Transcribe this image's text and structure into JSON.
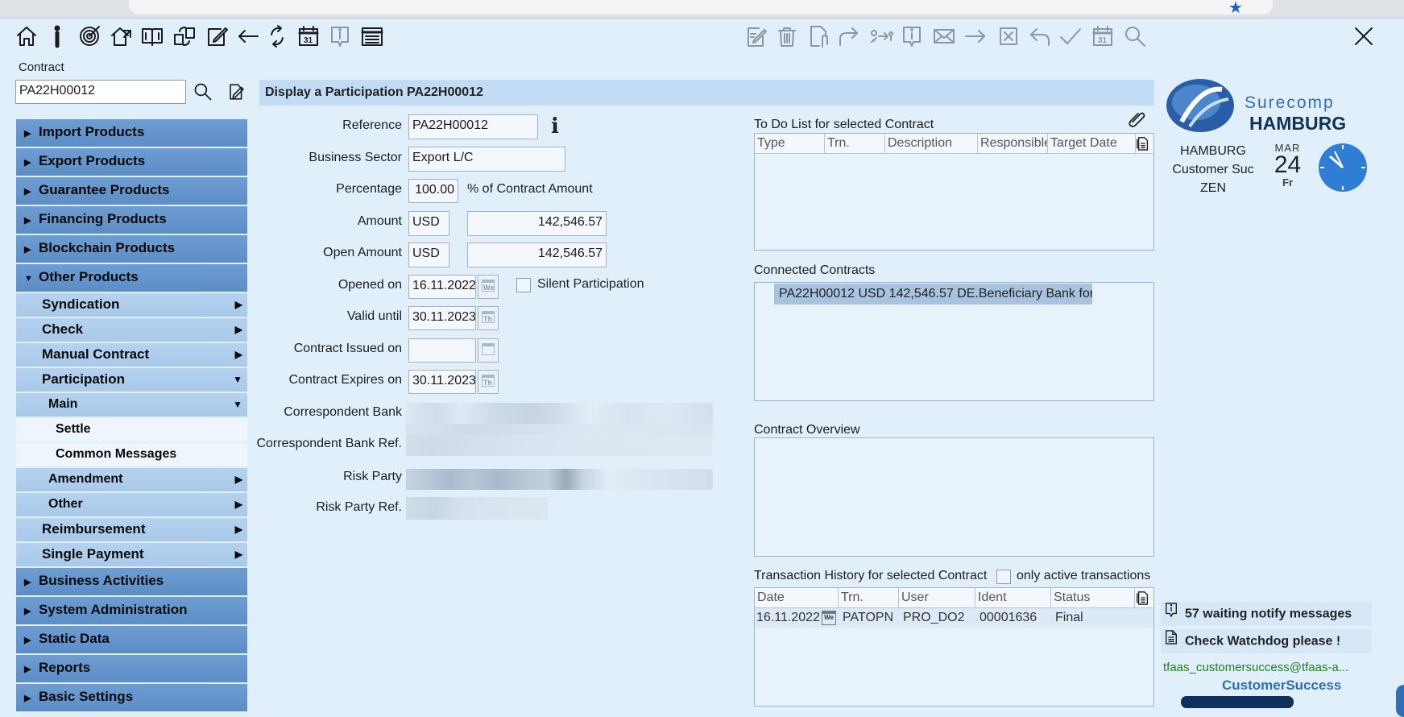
{
  "toolbar_left_icons": [
    "home-icon",
    "info-icon",
    "target-icon",
    "export-icon",
    "book-icon",
    "exchange-icon",
    "edit-icon",
    "back-arrow-icon",
    "refresh-icon",
    "calendar-icon",
    "info-box-icon",
    "list-icon"
  ],
  "toolbar_right_icons": [
    "edit-doc-icon",
    "trash-icon",
    "attach-doc-icon",
    "forward-icon",
    "route-icon",
    "info-box-icon",
    "mail-icon",
    "arrow-right-icon",
    "cancel-box-icon",
    "undo-icon",
    "check-icon",
    "calendar-icon",
    "search-icon"
  ],
  "contract_search": {
    "label": "Contract",
    "value": "PA22H00012"
  },
  "sidebar": {
    "top_items": [
      {
        "label": "Import Products"
      },
      {
        "label": "Export Products"
      },
      {
        "label": "Guarantee Products"
      },
      {
        "label": "Financing Products"
      },
      {
        "label": "Blockchain Products"
      },
      {
        "label": "Other Products"
      }
    ],
    "other_sub": [
      {
        "label": "Syndication"
      },
      {
        "label": "Check"
      },
      {
        "label": "Manual Contract"
      },
      {
        "label": "Participation"
      }
    ],
    "participation_sub": {
      "main": "Main",
      "main_children": [
        "Settle",
        "Common Messages"
      ],
      "amendment": "Amendment",
      "other": "Other"
    },
    "other_sub2": [
      {
        "label": "Reimbursement"
      },
      {
        "label": "Single Payment"
      }
    ],
    "bottom_items": [
      {
        "label": "Business Activities"
      },
      {
        "label": "System Administration"
      },
      {
        "label": "Static Data"
      },
      {
        "label": "Reports"
      },
      {
        "label": "Basic Settings"
      }
    ]
  },
  "page": {
    "title": "Display a Participation PA22H00012"
  },
  "form": {
    "reference": {
      "label": "Reference",
      "value": "PA22H00012"
    },
    "business_sector": {
      "label": "Business Sector",
      "value": "Export L/C"
    },
    "percentage": {
      "label": "Percentage",
      "value": "100.00",
      "suffix": "% of Contract Amount"
    },
    "amount": {
      "label": "Amount",
      "currency": "USD",
      "value": "142,546.57"
    },
    "open_amount": {
      "label": "Open Amount",
      "currency": "USD",
      "value": "142,546.57"
    },
    "opened_on": {
      "label": "Opened on",
      "value": "16.11.2022"
    },
    "silent_participation": {
      "label": "Silent Participation"
    },
    "valid_until": {
      "label": "Valid until",
      "value": "30.11.2023"
    },
    "contract_issued_on": {
      "label": "Contract Issued on",
      "value": ""
    },
    "contract_expires_on": {
      "label": "Contract Expires on",
      "value": "30.11.2023"
    },
    "correspondent_bank": {
      "label": "Correspondent Bank"
    },
    "correspondent_bank_ref": {
      "label": "Correspondent Bank Ref."
    },
    "risk_party": {
      "label": "Risk Party"
    },
    "risk_party_ref": {
      "label": "Risk Party Ref."
    }
  },
  "todo": {
    "label": "To Do List for selected Contract",
    "columns": [
      "Type",
      "Trn.",
      "Description",
      "Responsible",
      "Target Date"
    ]
  },
  "connected": {
    "label": "Connected Contracts",
    "items": [
      "PA22H00012 USD 142,546.57 DE.Beneficiary Bank for"
    ]
  },
  "overview": {
    "label": "Contract Overview"
  },
  "history": {
    "label": "Transaction History for selected Contract",
    "only_active": "only active transactions",
    "columns": [
      "Date",
      "Trn.",
      "User",
      "Ident",
      "Status"
    ],
    "rows": [
      {
        "date": "16.11.2022",
        "trn": "PATOPN",
        "user": "PRO_DO2",
        "ident": "00001636",
        "status": "Final"
      }
    ]
  },
  "branding": {
    "brand": "Surecomp",
    "city": "HAMBURG",
    "location_lines": [
      "HAMBURG",
      "Customer Suc",
      "ZEN"
    ],
    "month": "MAR",
    "day": "24",
    "weekday": "Fr"
  },
  "notifications": {
    "waiting": "57 waiting notify messages",
    "watchdog": "Check Watchdog please !",
    "email": "tfaas_customersuccess@tfaas-a...",
    "footer_brand": "CustomerSuccess"
  },
  "colors": {
    "background": "#e1effb",
    "nav_top": "#6d9dd2",
    "nav_sub": "#b5d2ef",
    "section_head": "#c2dcf5",
    "email_green": "#1f7f1f"
  }
}
